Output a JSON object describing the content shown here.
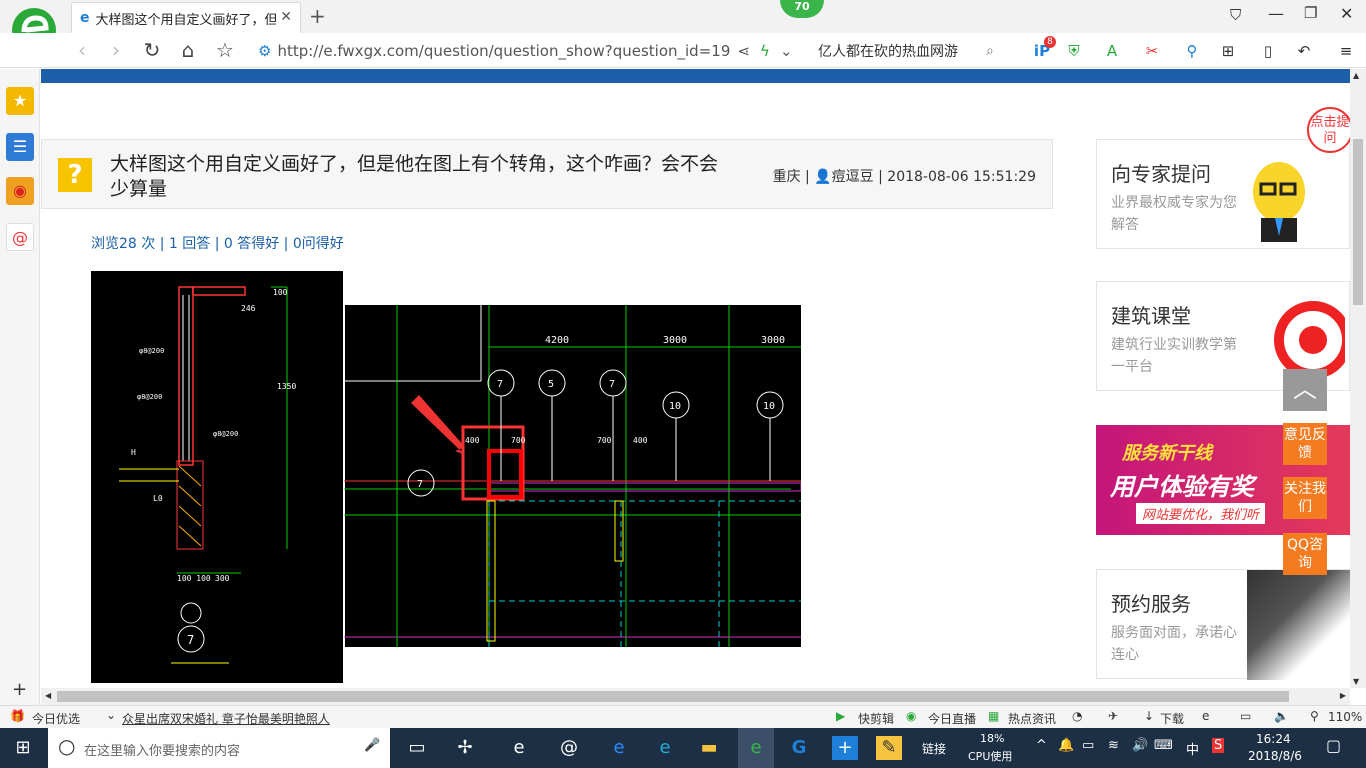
{
  "browser": {
    "tab_title": "大样图这个用自定义画好了，但是",
    "url": "http://e.fwxgx.com/question/question_show?question_id=19",
    "search_text": "亿人都在砍的热血网游",
    "badge_count": "70",
    "ext_badge": "8"
  },
  "question": {
    "title": "大样图这个用自定义画好了，但是他在图上有个转角，这个咋画？会不会少算量",
    "location": "重庆",
    "user": "痘逗豆",
    "datetime": "2018-08-06 15:51:29",
    "stats": "浏览28 次 | 1 回答 | 0 答得好 | 0问得好"
  },
  "cad": {
    "labels": [
      "100",
      "246",
      "φ8@200",
      "φ8@200",
      "φ8@200",
      "1350",
      "H",
      "L0",
      "100 100",
      "300",
      "7",
      "4200",
      "3000",
      "3000",
      "7",
      "5",
      "7",
      "10",
      "10",
      "400",
      "700",
      "700",
      "400",
      "7"
    ]
  },
  "right": {
    "expert": {
      "title": "向专家提问",
      "sub": "业界最权威专家为您解答"
    },
    "class": {
      "title": "建筑课堂",
      "sub": "建筑行业实训教学第一平台"
    },
    "banner": {
      "line1": "服务新干线",
      "line2": "用户体验有奖",
      "line3": "网站要优化，我们听"
    },
    "service": {
      "title": "预约服务",
      "sub": "服务面对面，承诺心连心"
    },
    "corner": "点击提问"
  },
  "floats": {
    "feedback": "意见反馈",
    "follow": "关注我们",
    "qq": "QQ咨询"
  },
  "status": {
    "today": "今日优选",
    "news": "众星出席双宋婚礼 章子怡最美明艳照人",
    "quickclip": "快剪辑",
    "live": "今日直播",
    "hot": "热点资讯",
    "download": "下载",
    "zoom": "110%"
  },
  "taskbar": {
    "search_placeholder": "在这里输入你要搜索的内容",
    "links": "链接",
    "cpu_pct": "18%",
    "cpu_label": "CPU使用",
    "ime": "中",
    "time": "16:24",
    "date": "2018/8/6"
  }
}
